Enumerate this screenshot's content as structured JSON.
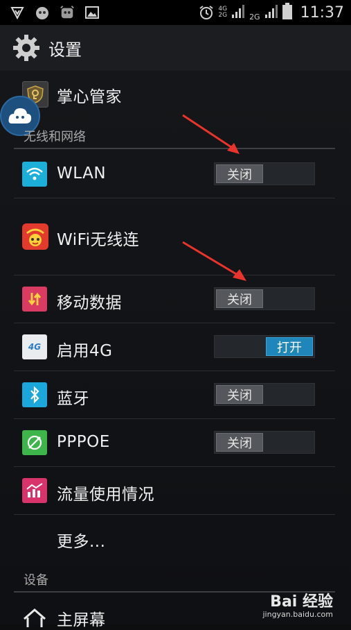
{
  "status_bar": {
    "time": "11:37",
    "sig1_top": "4G",
    "sig1_bottom": "2G",
    "sig2_label": "2G",
    "icons": [
      "shield-v-icon",
      "mascot-icon",
      "cow-icon",
      "image-icon",
      "alarm-icon",
      "signal-icon",
      "battery-icon"
    ]
  },
  "action_bar": {
    "title": "设置"
  },
  "top_item": {
    "label": "掌心管家"
  },
  "sections": {
    "wireless": "无线和网络",
    "device": "设备"
  },
  "items": [
    {
      "label": "WLAN",
      "switch": "关闭"
    },
    {
      "label": "WiFi无线连"
    },
    {
      "label": "移动数据",
      "switch": "关闭"
    },
    {
      "label": "启用4G",
      "switch": "打开"
    },
    {
      "label": "蓝牙",
      "switch": "关闭"
    },
    {
      "label": "PPPOE",
      "switch": "关闭"
    },
    {
      "label": "流量使用情况"
    },
    {
      "label": "更多..."
    },
    {
      "label": "主屏幕"
    }
  ],
  "icon_4g_text": "4G",
  "watermark": {
    "logo": "Bai 经验",
    "url": "jingyan.baidu.com"
  },
  "colors": {
    "accent_on": "#1f86b9",
    "arrow": "#e8342c"
  }
}
